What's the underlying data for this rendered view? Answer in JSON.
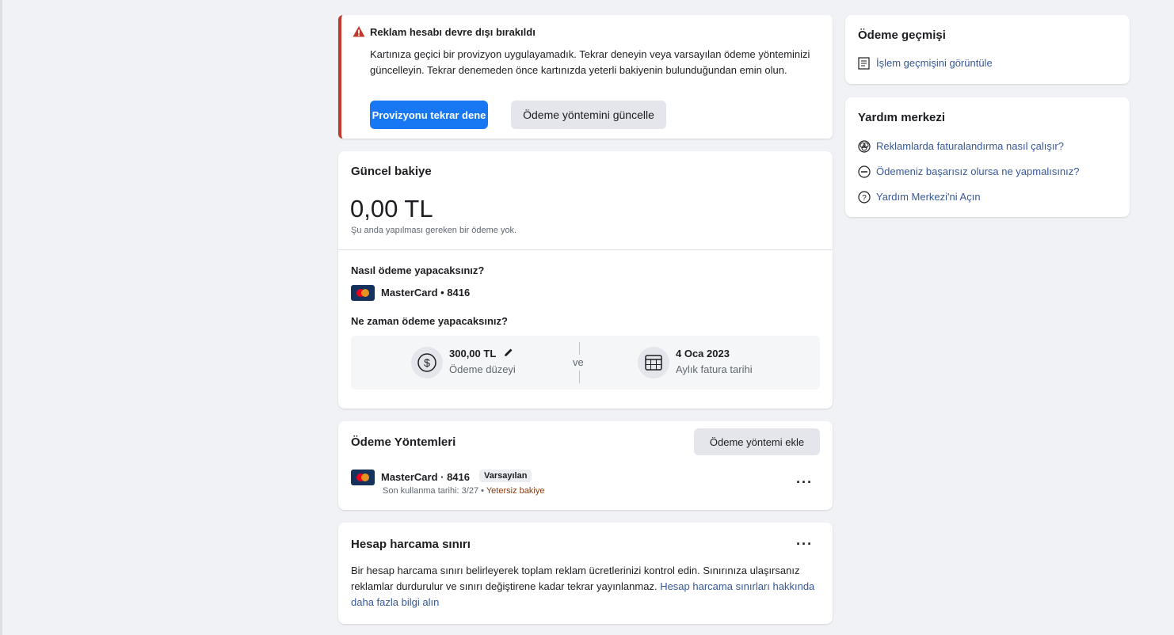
{
  "alert": {
    "title": "Reklam hesabı devre dışı bırakıldı",
    "message": "Kartınıza geçici bir provizyon uygulayamadık. Tekrar deneyin veya varsayılan ödeme yönteminizi güncelleyin. Tekrar denemeden önce kartınızda yeterli bakiyenin bulunduğundan emin olun.",
    "retry_label": "Provizyonu tekrar dene",
    "update_label": "Ödeme yöntemini güncelle",
    "accent": "#c0392b"
  },
  "balance": {
    "title": "Güncel bakiye",
    "amount": "0,00 TL",
    "note": "Şu anda yapılması gereken bir ödeme yok.",
    "how_title": "Nasıl ödeme yapacaksınız?",
    "card_label": "MasterCard • 8416",
    "when_title": "Ne zaman ödeme yapacaksınız?",
    "threshold_value": "300,00 TL",
    "threshold_label": "Ödeme düzeyi",
    "and_label": "ve",
    "bill_date": "4 Oca 2023",
    "bill_label": "Aylık fatura tarihi"
  },
  "methods": {
    "title": "Ödeme Yöntemleri",
    "add_label": "Ödeme yöntemi ekle",
    "card_label": "MasterCard · 8416",
    "default_badge": "Varsayılan",
    "last_used": "Son kullanma tarihi: 3/27",
    "status": "Yetersiz bakiye",
    "status_color": "#8a3b12"
  },
  "limit": {
    "title": "Hesap harcama sınırı",
    "text": "Bir hesap harcama sınırı belirleyerek toplam reklam ücretlerinizi kontrol edin. Sınırınıza ulaşırsanız reklamlar durdurulur ve sınırı değiştirene kadar tekrar yayınlanmaz.",
    "link": "Hesap harcama sınırları hakkında daha fazla bilgi alın"
  },
  "history": {
    "title": "Ödeme geçmişi",
    "link": "İşlem geçmişini görüntüle"
  },
  "help": {
    "title": "Yardım merkezi",
    "links": [
      "Reklamlarda faturalandırma nasıl çalışır?",
      "Ödemeniz başarısız olursa ne yapmalısınız?",
      "Yardım Merkezi'ni Açın"
    ]
  },
  "colors": {
    "primary": "#1877f2",
    "link": "#385898",
    "background": "#f0f2f5"
  }
}
